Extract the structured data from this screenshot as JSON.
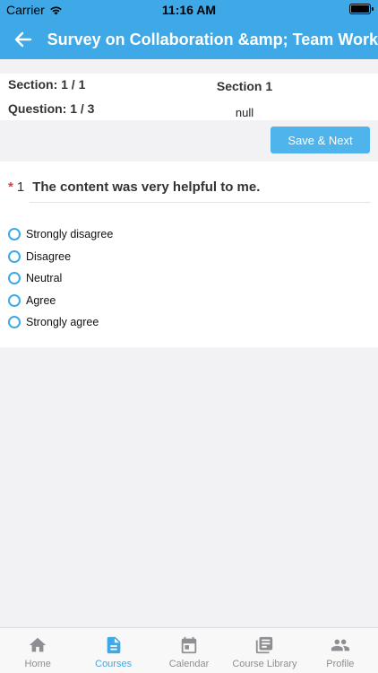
{
  "status_bar": {
    "carrier": "Carrier",
    "time": "11:16 AM"
  },
  "nav": {
    "title": "Survey on Collaboration &amp; Team Work"
  },
  "info": {
    "section_label": "Section: 1 / 1",
    "question_label": "Question: 1 / 3",
    "section_name": "Section 1",
    "section_description": "null"
  },
  "actions": {
    "save_next_label": "Save & Next"
  },
  "question": {
    "required_marker": "*",
    "number": "1",
    "text": "The content was very helpful to me.",
    "options": [
      "Strongly disagree",
      "Disagree",
      "Neutral",
      "Agree",
      "Strongly agree"
    ]
  },
  "tabs": [
    {
      "label": "Home",
      "icon": "home-icon",
      "active": false
    },
    {
      "label": "Courses",
      "icon": "document-icon",
      "active": true
    },
    {
      "label": "Calendar",
      "icon": "calendar-icon",
      "active": false
    },
    {
      "label": "Course Library",
      "icon": "library-icon",
      "active": false
    },
    {
      "label": "Profile",
      "icon": "people-icon",
      "active": false
    }
  ],
  "colors": {
    "primary": "#3ea9e6",
    "button": "#4fb4ec",
    "required": "#e23b3b",
    "tab_inactive": "#8e8e93"
  }
}
